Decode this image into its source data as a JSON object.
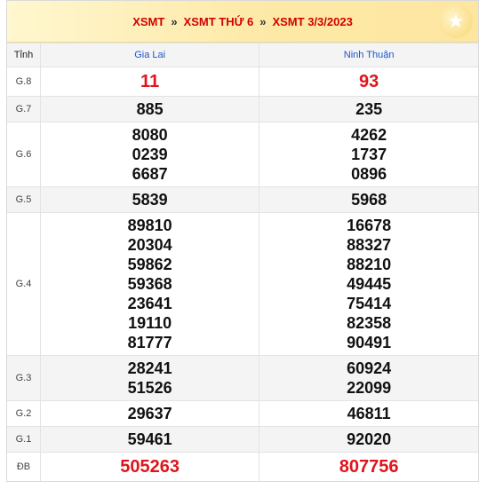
{
  "breadcrumb": {
    "home": "XSMT",
    "day": "XSMT THỨ 6",
    "date": "XSMT 3/3/2023",
    "separator": "»"
  },
  "table": {
    "label_header": "Tỉnh",
    "provinces": [
      "Gia Lai",
      "Ninh Thuận"
    ],
    "rows": [
      {
        "label": "G.8",
        "values": [
          [
            "11"
          ],
          [
            "93"
          ]
        ],
        "highlight": true
      },
      {
        "label": "G.7",
        "values": [
          [
            "885"
          ],
          [
            "235"
          ]
        ]
      },
      {
        "label": "G.6",
        "values": [
          [
            "8080",
            "0239",
            "6687"
          ],
          [
            "4262",
            "1737",
            "0896"
          ]
        ]
      },
      {
        "label": "G.5",
        "values": [
          [
            "5839"
          ],
          [
            "5968"
          ]
        ]
      },
      {
        "label": "G.4",
        "values": [
          [
            "89810",
            "20304",
            "59862",
            "59368",
            "23641",
            "19110",
            "81777"
          ],
          [
            "16678",
            "88327",
            "88210",
            "49445",
            "75414",
            "82358",
            "90491"
          ]
        ]
      },
      {
        "label": "G.3",
        "values": [
          [
            "28241",
            "51526"
          ],
          [
            "60924",
            "22099"
          ]
        ]
      },
      {
        "label": "G.2",
        "values": [
          [
            "29637"
          ],
          [
            "46811"
          ]
        ]
      },
      {
        "label": "G.1",
        "values": [
          [
            "59461"
          ],
          [
            "92020"
          ]
        ]
      },
      {
        "label": "ĐB",
        "values": [
          [
            "505263"
          ],
          [
            "807756"
          ]
        ],
        "highlight": true
      }
    ]
  },
  "colors": {
    "accent_red": "#e0141c",
    "province_blue": "#1a55c9",
    "header_bg": "#fde9a7"
  },
  "icons": {
    "decor": "star-icon"
  }
}
